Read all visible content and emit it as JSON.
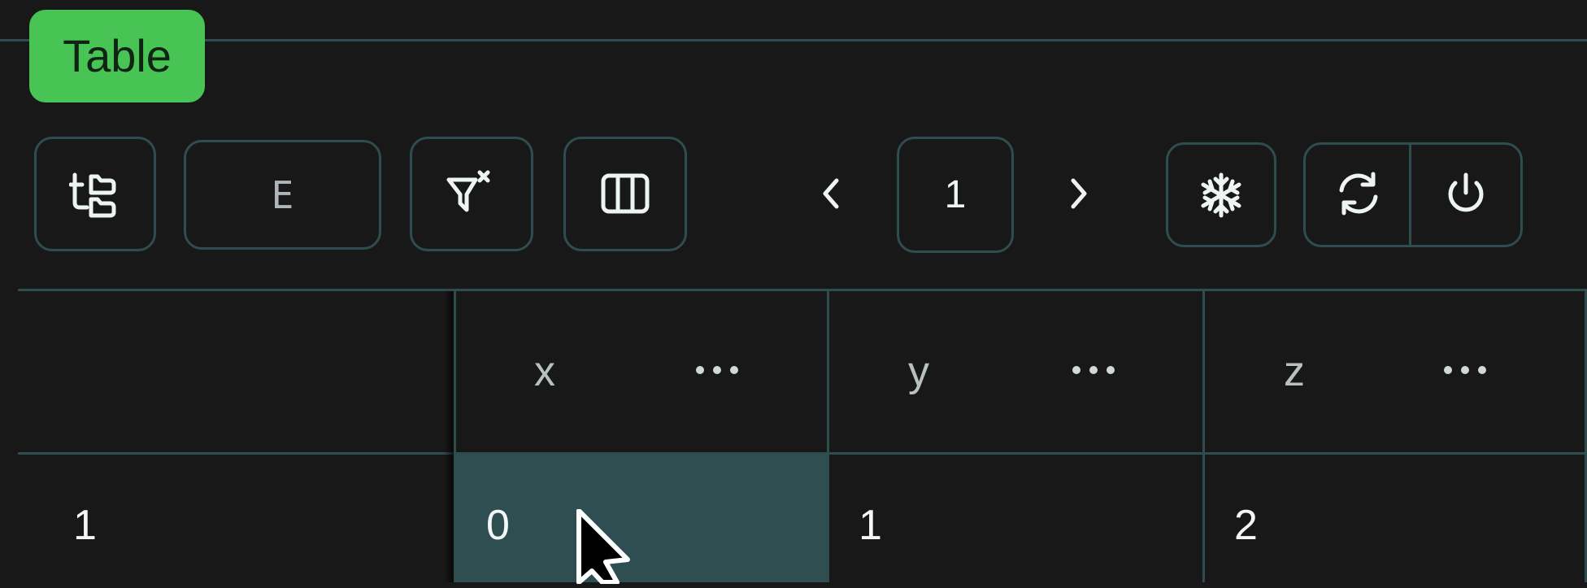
{
  "panel": {
    "label": "Table"
  },
  "toolbar": {
    "view_select_text": "E",
    "page_number": "1",
    "icons": {
      "tree_view": "folder-tree-icon",
      "clear_filters": "filter-x-icon",
      "columns": "columns-icon",
      "prev_page": "chevron-left-icon",
      "next_page": "chevron-right-icon",
      "freeze": "snowflake-icon",
      "refresh": "refresh-icon",
      "power": "power-icon",
      "column_menu": "ellipsis-icon"
    }
  },
  "table": {
    "columns": [
      "x",
      "y",
      "z"
    ],
    "rows": [
      {
        "index": "1",
        "values": [
          "0",
          "1",
          "2"
        ]
      }
    ],
    "selected_cell": {
      "row": 0,
      "column": "x"
    }
  },
  "colors": {
    "accent_green": "#48c455",
    "border_teal": "#2f4c4f",
    "selected_cell": "#2f4e52",
    "background": "#181818"
  }
}
